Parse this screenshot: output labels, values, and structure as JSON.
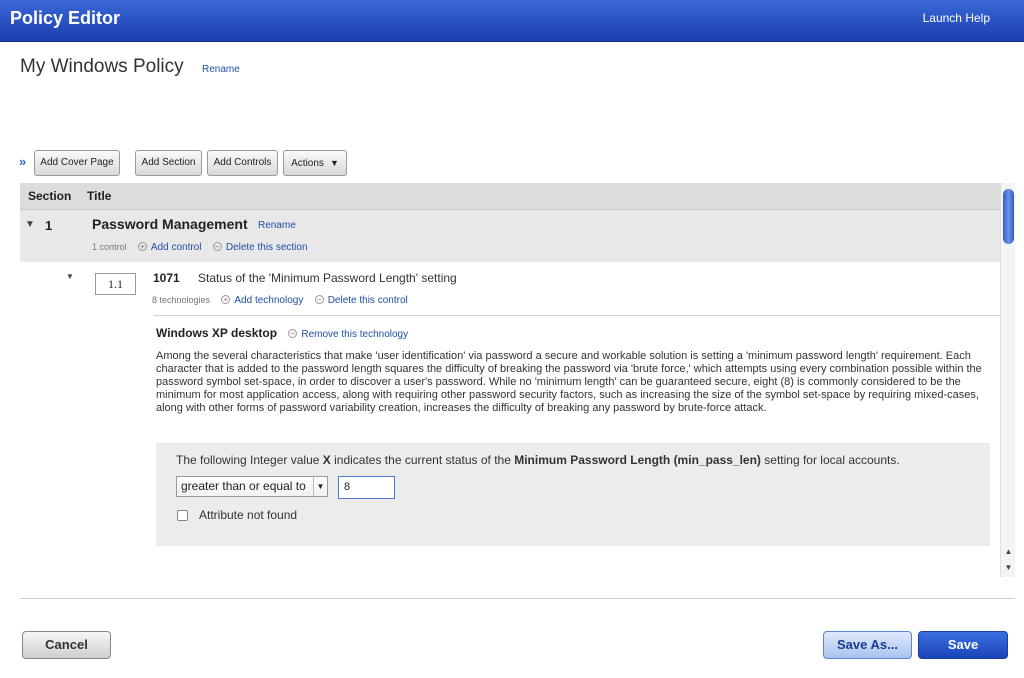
{
  "header": {
    "app_title": "Policy Editor",
    "help_label": "Launch Help",
    "brand_color": "#1c3fae"
  },
  "policy": {
    "title": "My Windows Policy",
    "rename_label": "Rename"
  },
  "toolbar": {
    "add_cover_page": "Add Cover Page",
    "add_section": "Add Section",
    "add_controls": "Add Controls",
    "actions": "Actions"
  },
  "grid": {
    "col_section": "Section",
    "col_title": "Title",
    "section": {
      "number": "1",
      "title": "Password Management",
      "rename_label": "Rename",
      "control_count": "1 control",
      "add_control": "Add control",
      "delete_section": "Delete this section",
      "control": {
        "number": "1.1",
        "id": "1071",
        "title": "Status of the 'Minimum Password Length' setting",
        "tech_count": "8 technologies",
        "add_technology": "Add technology",
        "delete_control": "Delete this control",
        "technology": {
          "name": "Windows XP desktop",
          "remove": "Remove this technology",
          "description": "Among the several characteristics that make 'user identification' via password a secure and workable solution is setting a 'minimum password length' requirement. Each character that is added to the password length squares the difficulty of breaking the password via 'brute force,' which attempts using every combination possible within the password symbol set-space, in order to discover a user's password. While no 'minimum length' can be guaranteed secure, eight (8) is commonly considered to be the minimum for most application access, along with requiring other password security factors, such as increasing the size of the symbol set-space by requiring mixed-cases, along with other forms of password variability creation, increases the difficulty of breaking any password by brute-force attack.",
          "setting": {
            "text_prefix": "The following Integer value ",
            "text_var": "X",
            "text_mid": " indicates the current status of the ",
            "text_setting": "Minimum Password Length (min_pass_len)",
            "text_suffix": " setting for local accounts.",
            "operator": "greater than or equal to",
            "value": "8",
            "checkbox_label": "Attribute not found"
          }
        }
      }
    }
  },
  "footer": {
    "cancel": "Cancel",
    "save_as": "Save As...",
    "save": "Save"
  }
}
